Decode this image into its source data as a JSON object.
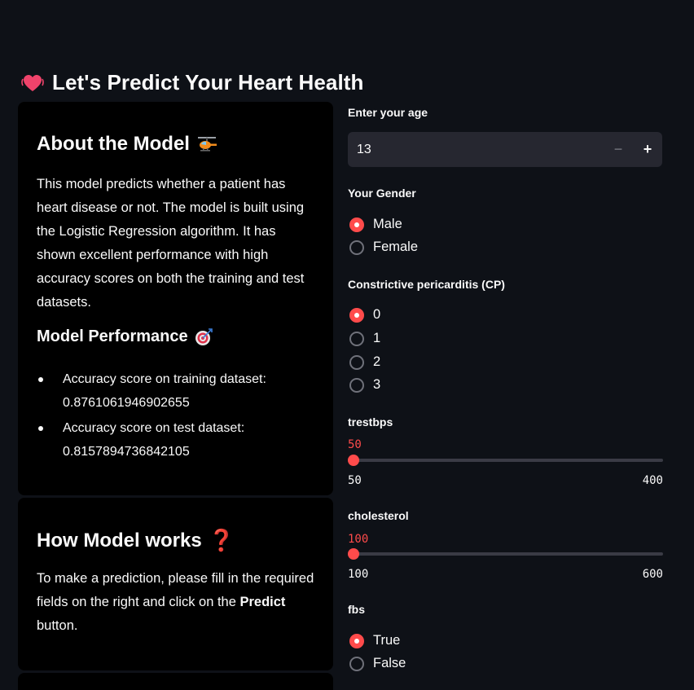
{
  "header": {
    "title": "Let's Predict Your Heart Health",
    "icon": "beating-heart-icon"
  },
  "about": {
    "heading": "About the Model",
    "heading_icon": "helicopter-icon",
    "description": "This model predicts whether a patient has heart disease or not. The model is built using the Logistic Regression algorithm. It has shown excellent performance with high accuracy scores on both the training and test datasets.",
    "performance_heading": "Model Performance",
    "performance_icon": "target-icon",
    "metrics": [
      "Accuracy score on training dataset: 0.8761061946902655",
      "Accuracy score on test dataset: 0.8157894736842105"
    ]
  },
  "how": {
    "heading": "How Model works",
    "heading_icon": "question-mark-icon",
    "text_before": "To make a prediction, please fill in the required fields on the right and click on the ",
    "text_bold": "Predict",
    "text_after": " button."
  },
  "form": {
    "age": {
      "label": "Enter your age",
      "value": "13",
      "minus": "−",
      "plus": "+"
    },
    "gender": {
      "label": "Your Gender",
      "options": [
        "Male",
        "Female"
      ],
      "selected": "Male"
    },
    "cp": {
      "label": "Constrictive pericarditis (CP)",
      "options": [
        "0",
        "1",
        "2",
        "3"
      ],
      "selected": "0"
    },
    "trestbps": {
      "label": "trestbps",
      "value": "50",
      "min": "50",
      "max": "400",
      "fraction": 0
    },
    "cholesterol": {
      "label": "cholesterol",
      "value": "100",
      "min": "100",
      "max": "600",
      "fraction": 0
    },
    "fbs": {
      "label": "fbs",
      "options": [
        "True",
        "False"
      ],
      "selected": "True"
    }
  },
  "colors": {
    "accent": "#ff4b4b",
    "background": "#0e1117",
    "card": "#000000",
    "input": "#262730"
  }
}
